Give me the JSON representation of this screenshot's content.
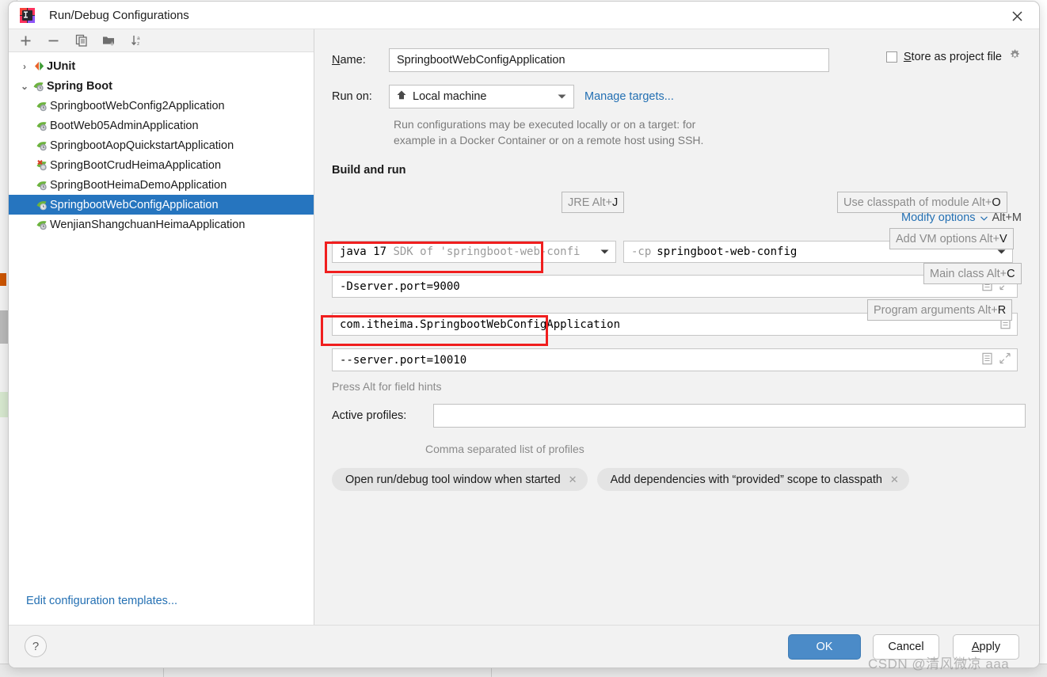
{
  "window": {
    "title": "Run/Debug Configurations",
    "app_icon": "intellij-idea-icon",
    "close_icon": "close-icon"
  },
  "tree_toolbar": {
    "buttons": [
      {
        "name": "add-configuration-button",
        "icon": "plus-icon",
        "glyph": "+"
      },
      {
        "name": "remove-configuration-button",
        "icon": "minus-icon",
        "glyph": "−"
      },
      {
        "name": "copy-configuration-button",
        "icon": "copy-icon",
        "glyph": "❐"
      },
      {
        "name": "new-folder-button",
        "icon": "folder-add-icon",
        "glyph": "὜0"
      },
      {
        "name": "sort-configurations-button",
        "icon": "sort-alphabetically-icon",
        "glyph": "↓"
      }
    ]
  },
  "tree": {
    "items": [
      {
        "label": "JUnit",
        "type": "group",
        "expanded": false,
        "twisty": "›",
        "icon": "junit-icon",
        "selected": false
      },
      {
        "label": "Spring Boot",
        "type": "group",
        "expanded": true,
        "twisty": "⌄",
        "icon": "spring-boot-icon",
        "selected": false
      },
      {
        "label": "SpringbootWebConfig2Application",
        "type": "leaf",
        "icon": "spring-boot-run-icon",
        "selected": false
      },
      {
        "label": "BootWeb05AdminApplication",
        "type": "leaf",
        "icon": "spring-boot-run-icon",
        "selected": false
      },
      {
        "label": "SpringbootAopQuickstartApplication",
        "type": "leaf",
        "icon": "spring-boot-run-icon",
        "selected": false
      },
      {
        "label": "SpringBootCrudHeimaApplication",
        "type": "leaf",
        "icon": "spring-boot-error-icon",
        "selected": false
      },
      {
        "label": "SpringBootHeimaDemoApplication",
        "type": "leaf",
        "icon": "spring-boot-run-icon",
        "selected": false
      },
      {
        "label": "SpringbootWebConfigApplication",
        "type": "leaf",
        "icon": "spring-boot-run-icon",
        "selected": true
      },
      {
        "label": "WenjianShangchuanHeimaApplication",
        "type": "leaf",
        "icon": "spring-boot-run-icon",
        "selected": false
      }
    ],
    "edit_templates_link": "Edit configuration templates..."
  },
  "form": {
    "name_label": "Name:",
    "name_label_mnemonic": "N",
    "name_value": "SpringbootWebConfigApplication",
    "store_as_project_file_label": "Store as project file",
    "store_as_project_file_mnemonic": "S",
    "store_as_project_file_checked": false,
    "store_gear_icon": "gear-icon",
    "run_on_label": "Run on:",
    "run_on_value": "Local machine",
    "run_on_icon": "local-machine-icon",
    "manage_targets_link": "Manage targets...",
    "run_on_description_line1": "Run configurations may be executed locally or on a target: for",
    "run_on_description_line2": "example in a Docker Container or on a remote host using SSH.",
    "build_and_run_title": "Build and run",
    "modify_options_label": "Modify options",
    "modify_options_shortcut": "Alt+M",
    "modify_options_icon": "chevron-down-icon",
    "sdk_value_bold": "java 17",
    "sdk_value_dim": "SDK of 'springboot-web-confi",
    "classpath_prefix": "-cp",
    "classpath_module": "springboot-web-config",
    "vm_options_value": "-Dserver.port=9000",
    "main_class_value": "com.itheima.SpringbootWebConfigApplication",
    "program_arguments_value": "--server.port=10010",
    "press_alt_hint": "Press Alt for field hints",
    "active_profiles_label": "Active profiles:",
    "active_profiles_value": "",
    "active_profiles_hint": "Comma separated list of profiles",
    "field_expand_icon": "expand-editor-icon",
    "field_list_icon": "browse-list-icon",
    "chips": [
      {
        "label": "Open run/debug tool window when started",
        "close_icon": "close-small-icon"
      },
      {
        "label": "Add dependencies with “provided” scope to classpath",
        "close_icon": "close-small-icon"
      }
    ]
  },
  "hints": [
    {
      "name": "hint-jre",
      "text": "JRE Alt+",
      "key": "J"
    },
    {
      "name": "hint-use-classpath-of-module",
      "text": "Use classpath of module Alt+",
      "key": "O"
    },
    {
      "name": "hint-add-vm-options",
      "text": "Add VM options Alt+",
      "key": "V"
    },
    {
      "name": "hint-main-class",
      "text": "Main class Alt+",
      "key": "C"
    },
    {
      "name": "hint-program-arguments",
      "text": "Program arguments Alt+",
      "key": "R"
    }
  ],
  "footer": {
    "help_label": "?",
    "ok_label": "OK",
    "cancel_label": "Cancel",
    "apply_label": "Apply",
    "apply_mnemonic": "A"
  },
  "watermark": "CSDN @清风微凉 aaa",
  "colors": {
    "accent_blue": "#2470b3",
    "selection_blue": "#2675bf",
    "ok_button_blue": "#4b8bc8",
    "highlight_red": "#f01e1e",
    "dialog_bg": "#f2f2f2",
    "field_bg": "#ffffff"
  }
}
